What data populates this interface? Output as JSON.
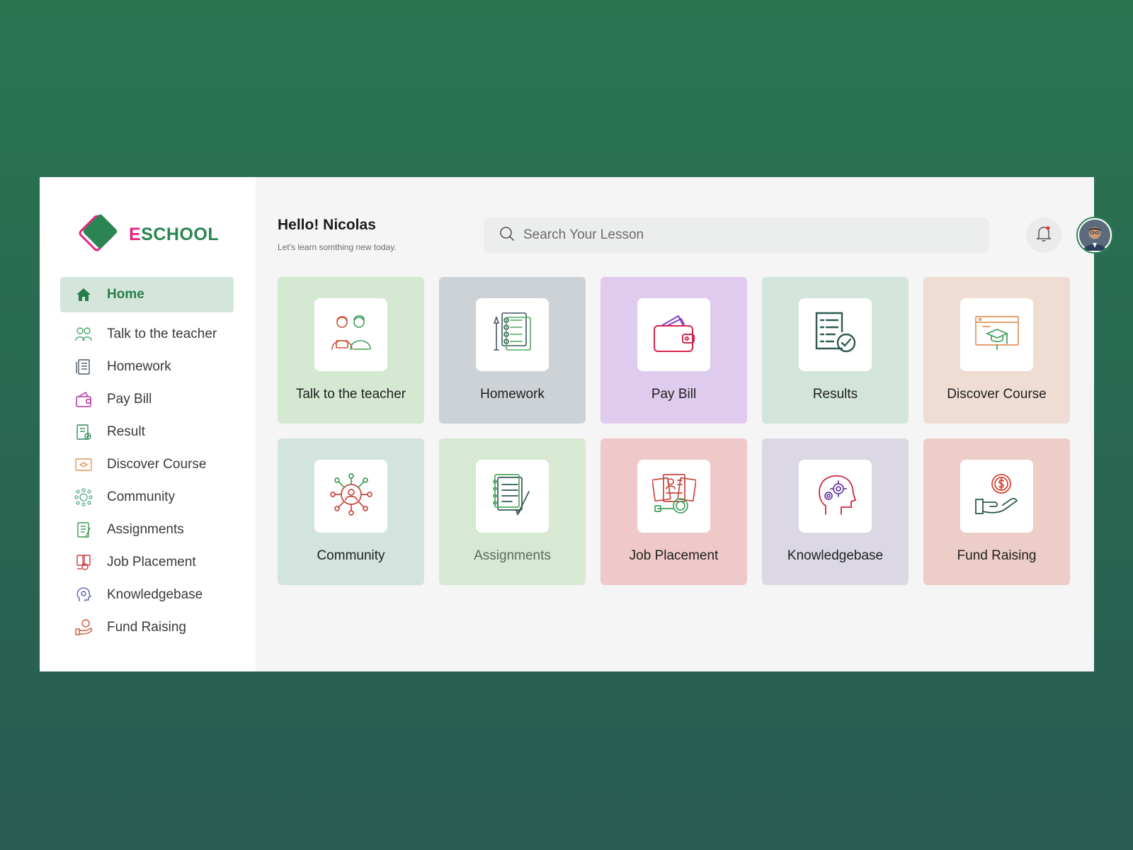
{
  "brand": {
    "first_letter": "E",
    "rest": "SCHOOL"
  },
  "header": {
    "greeting": "Hello! Nicolas",
    "subtitle": "Let’s learn somthing new today."
  },
  "search": {
    "placeholder": "Search Your Lesson"
  },
  "sidebar": {
    "items": [
      {
        "label": "Home",
        "icon": "home-icon",
        "active": true
      },
      {
        "label": "Talk to the teacher",
        "icon": "teacher-icon"
      },
      {
        "label": "Homework",
        "icon": "homework-icon"
      },
      {
        "label": "Pay Bill",
        "icon": "wallet-icon"
      },
      {
        "label": "Result",
        "icon": "result-icon"
      },
      {
        "label": "Discover Course",
        "icon": "course-icon"
      },
      {
        "label": "Community",
        "icon": "community-icon"
      },
      {
        "label": "Assignments",
        "icon": "assignments-icon"
      },
      {
        "label": "Job Placement",
        "icon": "job-icon"
      },
      {
        "label": "Knowledgebase",
        "icon": "knowledge-icon"
      },
      {
        "label": "Fund Raising",
        "icon": "fund-icon"
      }
    ]
  },
  "cards": [
    {
      "label": "Talk to the teacher",
      "icon": "teacher-icon",
      "bg": "#d4e8d2"
    },
    {
      "label": "Homework",
      "icon": "homework-icon",
      "bg": "#cdd2d6"
    },
    {
      "label": "Pay Bill",
      "icon": "wallet-icon",
      "bg": "#dfcbee"
    },
    {
      "label": "Results",
      "icon": "result-icon",
      "bg": "#d3e4da"
    },
    {
      "label": "Discover Course",
      "icon": "course-icon",
      "bg": "#efddd3"
    },
    {
      "label": "Community",
      "icon": "community-icon",
      "bg": "#d2e4dd"
    },
    {
      "label": "Assignments",
      "icon": "assignments-icon",
      "bg": "#d7e8d3"
    },
    {
      "label": "Job Placement",
      "icon": "job-icon",
      "bg": "#efc9c9"
    },
    {
      "label": "Knowledgebase",
      "icon": "knowledge-icon",
      "bg": "#dbd8e4"
    },
    {
      "label": "Fund Raising",
      "icon": "fund-icon",
      "bg": "#edcdc7"
    }
  ],
  "colors": {
    "accent": "#2a8552",
    "brand_pink": "#e8237e",
    "active_bg": "#d4e6db"
  }
}
